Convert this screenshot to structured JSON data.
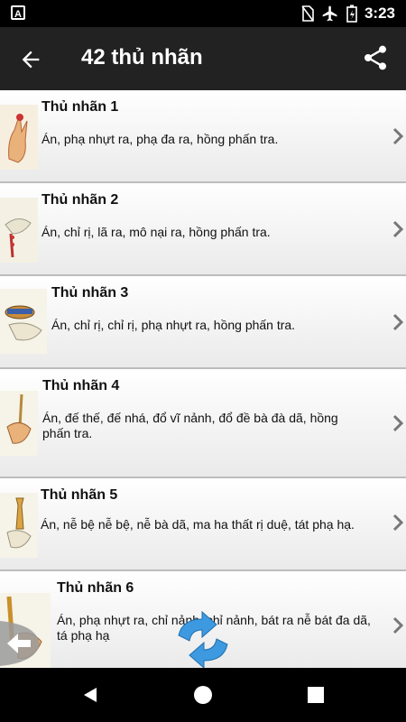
{
  "status": {
    "time": "3:23",
    "notification_letter": "A"
  },
  "appbar": {
    "title": "42 thủ nhãn"
  },
  "items": [
    {
      "title": "Thủ nhãn 1",
      "desc": "Án, phạ nhựt ra, phạ đa ra, hồng phấn tra."
    },
    {
      "title": "Thủ nhãn 2",
      "desc": "Án, chỉ rị, lã ra, mô nại ra, hồng phấn tra."
    },
    {
      "title": "Thủ nhãn 3",
      "desc": "Án, chỉ rị, chỉ rị, phạ nhựt ra, hồng phấn tra."
    },
    {
      "title": "Thủ nhãn 4",
      "desc": "Án, đế thế, đế nhá, đổ vĩ nảnh, đổ đề bà đà dã, hồng phấn tra."
    },
    {
      "title": "Thủ nhãn 5",
      "desc": "Án, nễ bệ nễ bệ, nễ bà dã, ma ha thất rị duệ, tát phạ hạ."
    },
    {
      "title": "Thủ nhãn 6",
      "desc": "Án, phạ nhựt ra, chỉ nảnh, chỉ nảnh, bát ra nễ bát đa dã, tá phạ hạ"
    }
  ],
  "colors": {
    "appbar": "#222222",
    "statusbar": "#000000",
    "divider": "#bdbdbd",
    "accent_refresh": "#2f8fd8"
  }
}
